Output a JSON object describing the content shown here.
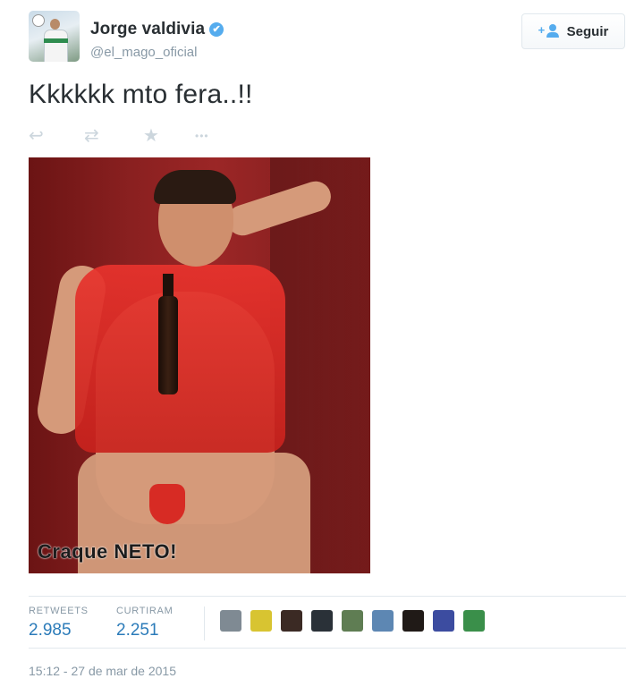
{
  "user": {
    "name": "Jorge valdivia",
    "handle": "@el_mago_oficial",
    "verified_icon": "✔"
  },
  "follow_button": {
    "label": "Seguir"
  },
  "tweet": {
    "text": "Kkkkkk mto fera..!!",
    "image_caption": "Craque NETO!"
  },
  "actions": [
    {
      "icon": "reply-icon",
      "glyph": "↩"
    },
    {
      "icon": "retweet-icon",
      "glyph": "⇄"
    },
    {
      "icon": "favorite-star-icon",
      "glyph": "★"
    },
    {
      "icon": "more-icon",
      "glyph": "•••"
    }
  ],
  "stats": {
    "retweets": {
      "label": "RETWEETS",
      "value": "2.985"
    },
    "likes": {
      "label": "CURTIRAM",
      "value": "2.251"
    }
  },
  "favoriters": [
    {
      "color": "#7f8a93"
    },
    {
      "color": "#d8c431"
    },
    {
      "color": "#3b2a24"
    },
    {
      "color": "#2a3138"
    },
    {
      "color": "#5f7d53"
    },
    {
      "color": "#5d87b3"
    },
    {
      "color": "#201a17"
    },
    {
      "color": "#3c4ca0"
    },
    {
      "color": "#3a8f4a"
    }
  ],
  "timestamp": "15:12 - 27 de mar de 2015",
  "colors": {
    "accent": "#55acee",
    "link": "#2b7bb9",
    "muted": "#8899a6"
  }
}
